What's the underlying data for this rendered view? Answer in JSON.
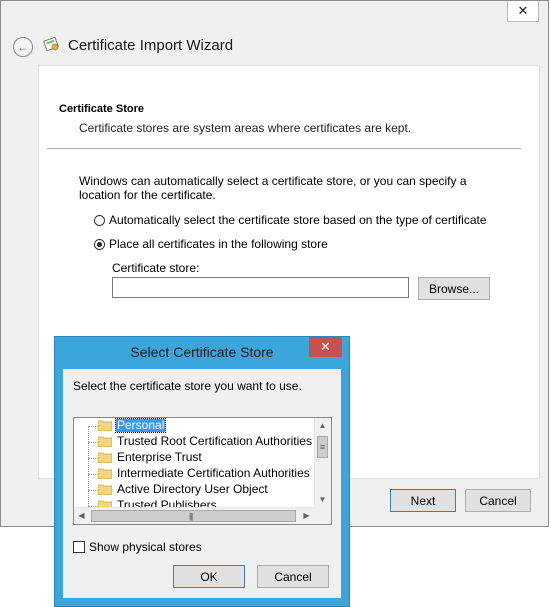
{
  "wizard": {
    "title": "Certificate Import Wizard",
    "close_glyph": "✕",
    "back_glyph": "←",
    "section_title": "Certificate Store",
    "section_subtitle": "Certificate stores are system areas where certificates are kept.",
    "description": "Windows can automatically select a certificate store, or you can specify a location for the certificate.",
    "radio_auto": "Automatically select the certificate store based on the type of certificate",
    "radio_manual": "Place all certificates in the following store",
    "selected_option": "manual",
    "store_label": "Certificate store:",
    "store_value": "",
    "browse_label": "Browse...",
    "next_label": "Next",
    "cancel_label": "Cancel"
  },
  "dialog": {
    "title": "Select Certificate Store",
    "close_glyph": "✕",
    "prompt": "Select the certificate store you want to use.",
    "stores": [
      "Personal",
      "Trusted Root Certification Authorities",
      "Enterprise Trust",
      "Intermediate Certification Authorities",
      "Active Directory User Object",
      "Trusted Publishers"
    ],
    "selected_store": "Personal",
    "show_physical_label": "Show physical stores",
    "show_physical_checked": false,
    "ok_label": "OK",
    "cancel_label": "Cancel"
  },
  "colors": {
    "dialog_frame": "#3aa6dc",
    "close_red": "#c75050",
    "selection": "#3399ff",
    "folder": "#f5d77a"
  }
}
